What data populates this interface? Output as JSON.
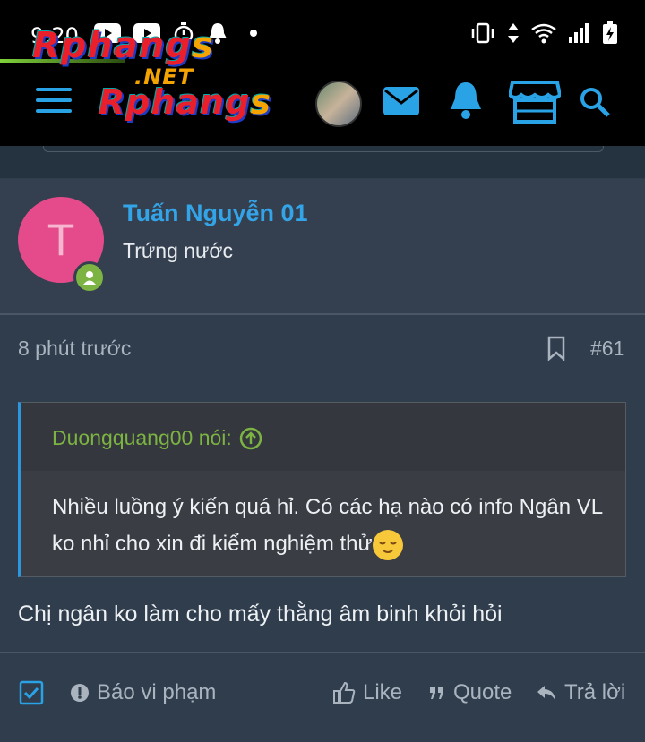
{
  "status_bar": {
    "time": "9:20"
  },
  "header": {
    "logo_top": [
      "Rphang",
      "s"
    ],
    "logo_net": ".NET",
    "logo_bottom": [
      "Rphang",
      "s"
    ]
  },
  "post": {
    "username": "Tuấn Nguyễn 01",
    "user_title": "Trứng nước",
    "avatar_letter": "T",
    "avatar_color": "#e54b8a",
    "time_ago": "8 phút trước",
    "post_number": "#61",
    "quote": {
      "author_label": "Duongquang00 nói:",
      "text": "Nhiều luồng ý kiến quá hỉ. Có các hạ nào có info Ngân VL ko nhỉ cho xin đi kiểm nghiệm thử"
    },
    "body": "Chị ngân ko làm cho mấy thằng âm binh khỏi hỏi"
  },
  "actions": {
    "report": "Báo vi phạm",
    "like": "Like",
    "quote": "Quote",
    "reply": "Trả lời"
  },
  "colors": {
    "accent": "#34a4e8",
    "online": "#7cb342",
    "background": "#2f3d4d"
  }
}
